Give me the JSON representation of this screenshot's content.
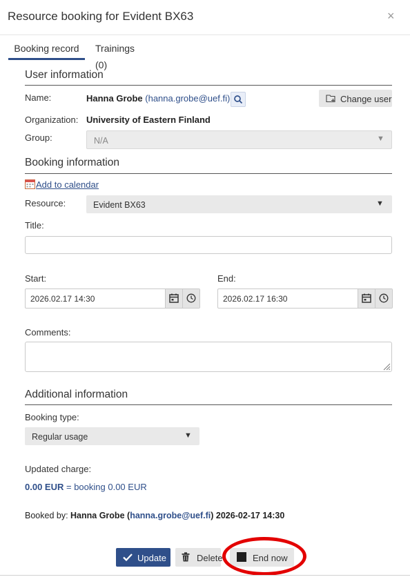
{
  "dialog": {
    "title": "Resource booking for Evident BX63",
    "close_symbol": "×"
  },
  "tabs": [
    {
      "label": "Booking record",
      "active": true
    },
    {
      "label": "Trainings (0)",
      "active": false
    }
  ],
  "user_info": {
    "heading": "User information",
    "name_label": "Name:",
    "name": "Hanna Grobe",
    "email": "hanna.grobe@uef.fi",
    "change_user_label": "Change user",
    "org_label": "Organization:",
    "organization": "University of Eastern Finland",
    "group_label": "Group:",
    "group_value": "N/A"
  },
  "booking_info": {
    "heading": "Booking information",
    "add_calendar": "Add to calendar",
    "resource_label": "Resource:",
    "resource_value": "Evident BX63",
    "title_label": "Title:",
    "title_value": "",
    "start_label": "Start:",
    "start_value": "2026.02.17 14:30",
    "end_label": "End:",
    "end_value": "2026.02.17 16:30",
    "comments_label": "Comments:",
    "comments_value": ""
  },
  "additional": {
    "heading": "Additional information",
    "booking_type_label": "Booking type:",
    "booking_type_value": "Regular usage",
    "charge_label": "Updated charge:",
    "charge_amount": "0.00 EUR",
    "charge_detail": "= booking 0.00 EUR"
  },
  "booked_by": {
    "prefix": "Booked by:",
    "name": "Hanna Grobe",
    "email": "hanna.grobe@uef.fi",
    "datetime": "2026-02-17 14:30"
  },
  "actions": {
    "update": "Update",
    "delete": "Delete",
    "end_now": "End now"
  },
  "colors": {
    "accent": "#2f4f8a",
    "highlight_ring": "#e30000"
  }
}
